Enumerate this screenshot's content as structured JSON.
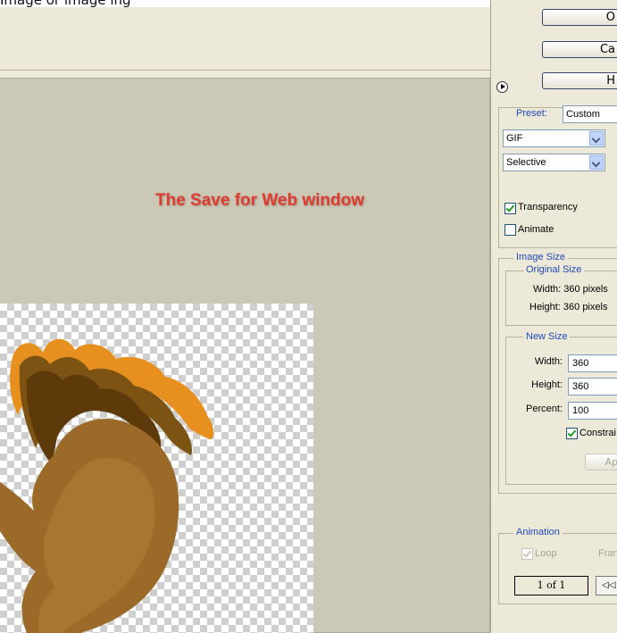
{
  "header": {
    "caption_fragment": "Image or image ing"
  },
  "preview": {
    "title": "The Save for Web window"
  },
  "buttons": {
    "ok": "O",
    "cancel": "Ca",
    "help": "H"
  },
  "settings": {
    "preset_label": "Preset:",
    "preset_value": "Custom",
    "format_value": "GIF",
    "reduction_value": "Selective",
    "transparency_label": "Transparency",
    "transparency_checked": true,
    "animate_label": "Animate",
    "animate_checked": false
  },
  "image_size": {
    "title": "Image Size",
    "original_title": "Original Size",
    "width_text": "Width:  360 pixels",
    "height_text": "Height:  360 pixels",
    "new_title": "New Size",
    "width_label": "Width:",
    "width_value": "360",
    "height_label": "Height:",
    "height_value": "360",
    "percent_label": "Percent:",
    "percent_value": "100",
    "constrain_label": "Constrai",
    "apply_label": "Ap"
  },
  "animation": {
    "title": "Animation",
    "loop_label": "Loop",
    "frame_label": "Fran",
    "counter": "1 of 1",
    "first_button": "◁◁"
  },
  "colors": {
    "accent_title": "#1f49b9",
    "preview_title": "#e03a2e"
  }
}
